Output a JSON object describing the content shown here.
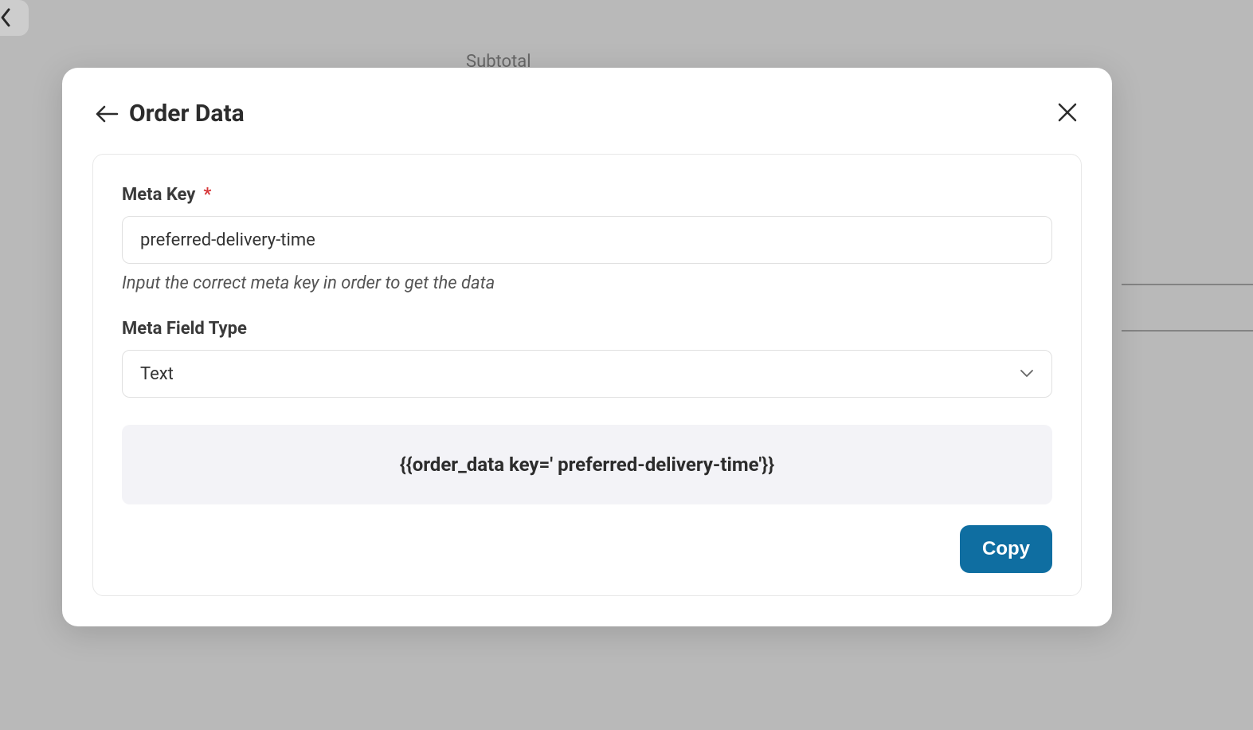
{
  "background": {
    "subtotal_label": "Subtotal"
  },
  "modal": {
    "title": "Order Data",
    "meta_key": {
      "label": "Meta Key",
      "required_marker": "*",
      "value": "preferred-delivery-time",
      "help": "Input the correct meta key in order to get the data"
    },
    "meta_field_type": {
      "label": "Meta Field Type",
      "selected": "Text"
    },
    "code_snippet": "{{order_data key=' preferred-delivery-time'}}",
    "copy_button": "Copy"
  }
}
